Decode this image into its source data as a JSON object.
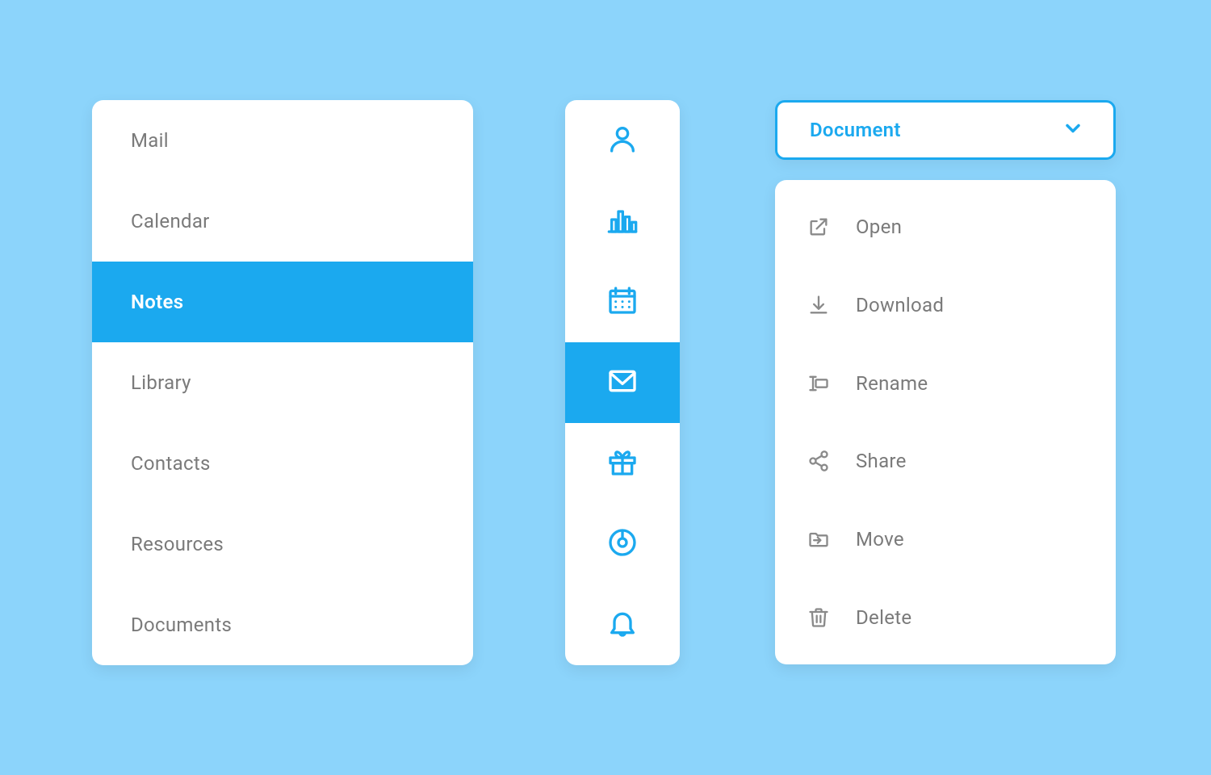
{
  "colors": {
    "background": "#8cd4fb",
    "accent": "#1ba9ef",
    "card": "#ffffff",
    "text_muted": "#7a7a7a",
    "icon_muted": "#8a8a8a"
  },
  "nav": {
    "active_index": 2,
    "items": [
      {
        "label": "Mail"
      },
      {
        "label": "Calendar"
      },
      {
        "label": "Notes"
      },
      {
        "label": "Library"
      },
      {
        "label": "Contacts"
      },
      {
        "label": "Resources"
      },
      {
        "label": "Documents"
      }
    ]
  },
  "icon_rail": {
    "active_index": 3,
    "items": [
      {
        "icon": "user-icon"
      },
      {
        "icon": "bar-chart-icon"
      },
      {
        "icon": "calendar-icon"
      },
      {
        "icon": "mail-icon"
      },
      {
        "icon": "gift-icon"
      },
      {
        "icon": "disc-icon"
      },
      {
        "icon": "bell-icon"
      }
    ]
  },
  "dropdown": {
    "selected_label": "Document",
    "menu": [
      {
        "icon": "open-external-icon",
        "label": "Open"
      },
      {
        "icon": "download-icon",
        "label": "Download"
      },
      {
        "icon": "rename-icon",
        "label": "Rename"
      },
      {
        "icon": "share-icon",
        "label": "Share"
      },
      {
        "icon": "folder-move-icon",
        "label": "Move"
      },
      {
        "icon": "trash-icon",
        "label": "Delete"
      }
    ]
  }
}
